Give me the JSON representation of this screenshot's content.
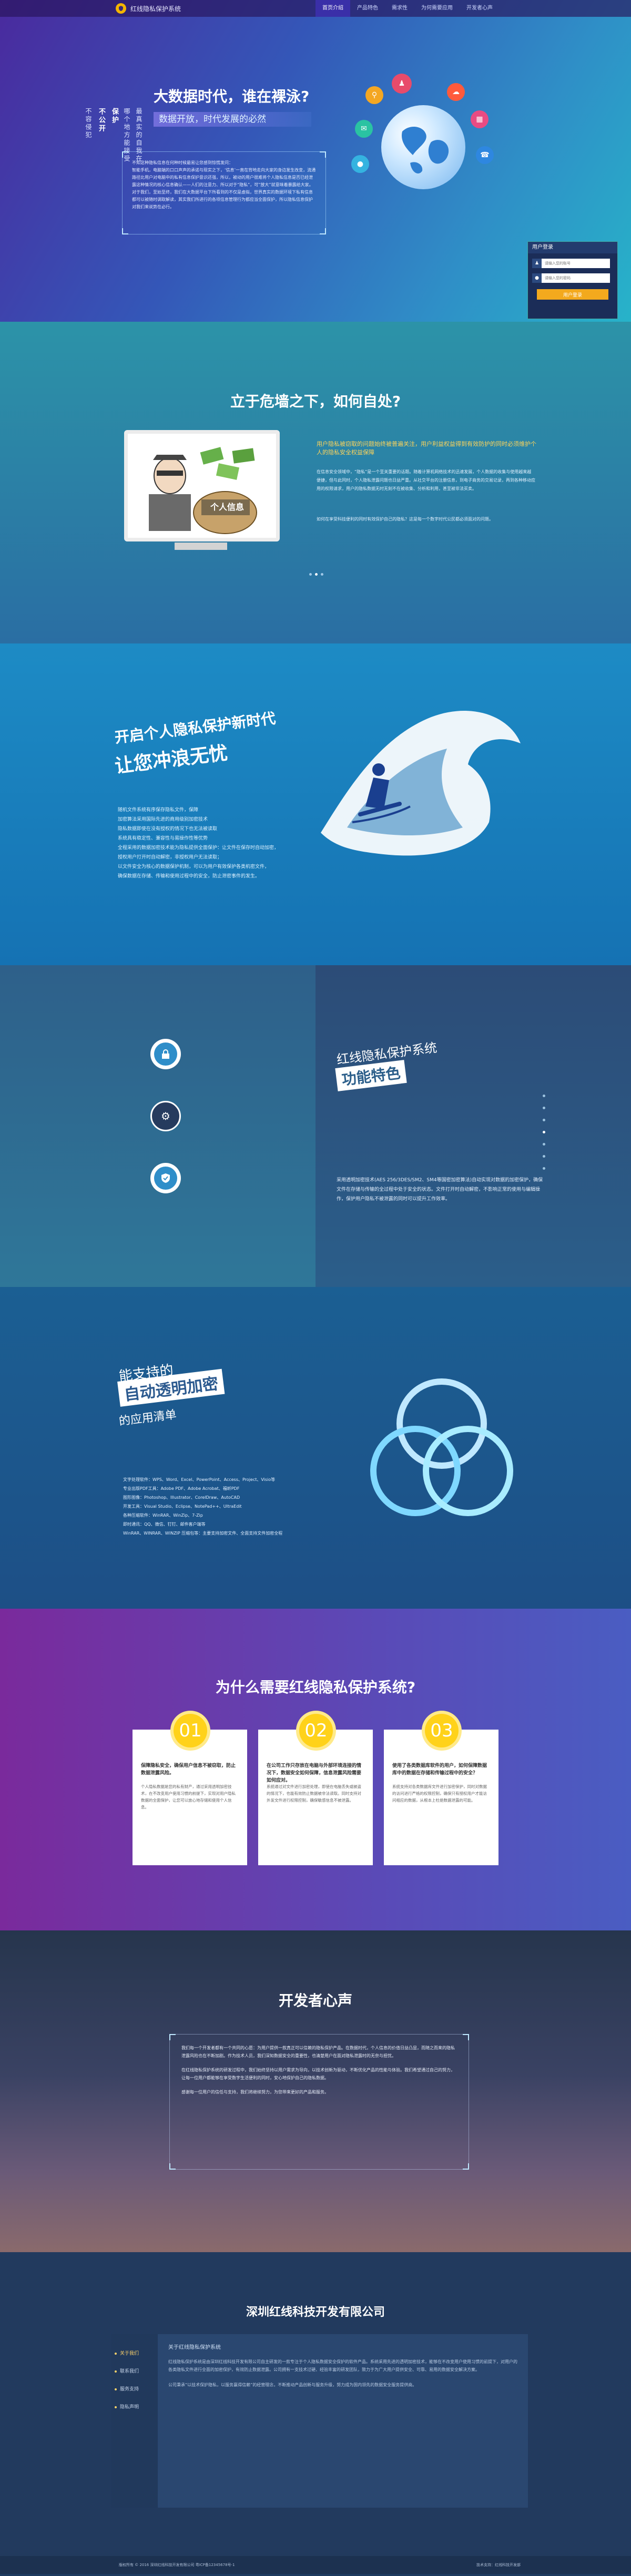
{
  "nav": {
    "brand": "红线隐私保护系统",
    "links": [
      "首页介绍",
      "产品特色",
      "需求性",
      "为何需要应用",
      "开发者心声"
    ]
  },
  "hero": {
    "vertical_cols": [
      "最真实的自我在",
      "哪个地方能接受",
      "保护",
      "不公开",
      "不容侵犯"
    ],
    "title": "大数据时代，谁在裸泳?",
    "subtitle": "数据开放，时代发展的必然",
    "text": "      不知这种隐私信息在何种时候最易让您感到惊慌发问：\n      智能手机，电脑端的口口声声的承诺与现实之下，‘信息’一直在背地走向大家的身边发生改变，流通路径比用户对电脑中的私有信息保护意识还强，所以，被动的用户很难将个人隐私信息是否已经泄露这种情况的核心信息确认——人们的注意力、所以对于“隐私”，可“放大”就意味着暴露给大家。对于我们，至始至终，我们在大数据平台下所看到的不仅是虚拟，世界真实的数据环境下私有信息都可以被随时调取解读，其实我们所进行的各项信息管理行为都应当全面保护，所以隐私信息保护对我们来说势在必行。",
    "login": {
      "title": "用户登录",
      "user_placeholder": "请输入您的账号",
      "pass_placeholder": "请输入您的密码",
      "button": "用户登录"
    }
  },
  "dilemma": {
    "title": "立于危墙之下，如何自处?",
    "image_label": "个人信息",
    "note": "用户隐私被窃取的问题始终被普遍关注，用户利益权益得到有效防护的同时必须维护个人的隐私安全权益保障",
    "p1": "在信息安全领域中，“隐私”是一个至关重要的话题。随着计算机网络技术的迅速发展，个人数据的收集与使用越来越便捷，但与此同时，个人隐私泄露问题也日益严重。从社交平台的注册信息，到电子商务的交易记录，再到各种移动应用的权限请求，用户的隐私数据无时无刻不在被收集、分析和利用，甚至被非法买卖。",
    "p2": "如何在享受科技便利的同时有效保护自己的隐私？这是每一个数字时代公民都必须面对的问题。"
  },
  "surf": {
    "title1": "开启个人隐私保护新时代",
    "title2": "让您冲浪无忧",
    "lines": [
      "随机文件系统有序保存隐私文件，保障",
      "加密算法采用国际先进的商用级别加密技术",
      "隐私数据即使在没有授权的情况下也无法被读取",
      "系统具有稳定性、兼容性与易操作性等优势",
      "全程采用的数据加密技术能为隐私提供全面保护：让文件在保存时自动加密，",
      "授权用户打开时自动解密，非授权用户无法读取；",
      "以文件安全为核心的数据保护机制，可以为用户有效保护各类机密文件，",
      "确保数据在存储、传输和使用过程中的安全，防止泄密事件的发生。"
    ]
  },
  "features": {
    "icons": [
      "lock-icon",
      "gear-icon",
      "shield-icon"
    ],
    "title1": "红线隐私保护系统",
    "title2": "功能特色",
    "text": "采用透明加密技术(AES 256/3DES/SM2、SM4等国密加密算法)自动实现对数据的加密保护，确保文件在存储与传输的全过程中处于安全的状态。文件打开时自动解密，不影响正常的使用与编辑操作，保护用户隐私不被泄露的同时可以提升工作效率。"
  },
  "apps": {
    "title1": "能支持的",
    "title2": "自动透明加密",
    "title3": "的应用清单",
    "items": [
      "文字处理软件：WPS、Word、Excel、PowerPoint、Access、Project、Visio等",
      "专业出版PDF工具：Adobe PDF、Adobe Acrobat、福昕PDF",
      "图形图像：Photoshop、Illustrator、CorelDraw、AutoCAD",
      "开发工具：Visual Studio、Eclipse、NotePad++、UltraEdit",
      "各种压缩软件：WinRAR、WinZip、7-Zip",
      "即时通讯：QQ、微信、钉钉、邮件客户端等",
      "WinRAR、WINRAR、WINZIP 压缩包等：主要支持加密文件、全面支持文件加密全程"
    ]
  },
  "why": {
    "title": "为什么需要红线隐私保护系统?",
    "cards": [
      {
        "num": "01",
        "heading": "保障隐私安全，确保用户信息不被窃取，防止数据泄露风险。",
        "text": "个人隐私数据是您的私有财产，通过采用透明加密技术，在不改变用户使用习惯的前提下，实现对用户隐私数据的全面保护，让您可以放心地存储和使用个人信息。"
      },
      {
        "num": "02",
        "heading": "在公司工作只存放在电脑与外部环境连接的情况下，数据安全如何保障，信息泄露风险需要如何应对。",
        "text": "系统通过对文件进行加密处理，即使在电脑丢失或被盗的情况下，也能有效防止数据被非法读取。同时支持对外发文件进行权限控制，确保敏感信息不被泄露。"
      },
      {
        "num": "03",
        "heading": "使用了各类数据库软件的用户，如何保障数据库中的数据在存储和传输过程中的安全？",
        "text": "系统支持对各类数据库文件进行加密保护，同时对数据的访问进行严格的权限控制，确保只有授权用户才能访问相应的数据，从根本上杜绝数据泄露的可能。"
      }
    ]
  },
  "devs": {
    "title": "开发者心声",
    "paragraphs": [
      "我们每一个开发者都有一个共同的心愿：为用户提供一款真正可以信赖的隐私保护产品。在数据时代，个人信息的价值日益凸显，而随之而来的隐私泄露风险也在不断加剧。作为技术人员，我们深知数据安全的重要性，也清楚用户在面对隐私泄露时的无奈与担忧。",
      "在红线隐私保护系统的研发过程中，我们始终坚持以用户需求为导向，以技术创新为驱动，不断优化产品的性能与体验。我们希望通过自己的努力，让每一位用户都能够在享受数字生活便利的同时，安心地保护自己的隐私数据。",
      "感谢每一位用户的信任与支持，我们将继续努力，为您带来更好的产品和服务。"
    ]
  },
  "company": {
    "title": "深圳红线科技开发有限公司",
    "tabs": [
      "关于我们",
      "联系我们",
      "服务支持",
      "隐私声明"
    ],
    "heading": "关于红线隐私保护系统",
    "p1": "红线隐私保护系统是由深圳红线科技开发有限公司自主研发的一款专注于个人隐私数据安全保护的软件产品。系统采用先进的透明加密技术，能够在不改变用户使用习惯的前提下，对用户的各类隐私文件进行全面的加密保护，有效防止数据泄露。公司拥有一支技术过硬、经验丰富的研发团队，致力于为广大用户提供安全、可靠、易用的数据安全解决方案。",
    "p2": "公司秉承“以技术保护隐私，以服务赢得信赖”的经营理念，不断推动产品创新与服务升级，努力成为国内领先的数据安全服务提供商。",
    "footer_left": "版权所有 © 2016  深圳红线科技开发有限公司  粤ICP备12345678号-1",
    "footer_right": "技术支持：红线科技开发部"
  }
}
